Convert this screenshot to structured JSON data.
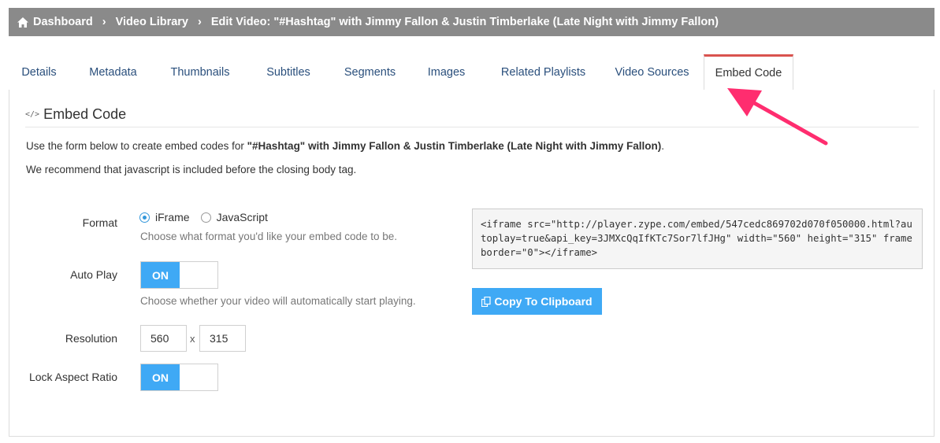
{
  "breadcrumb": {
    "items": [
      "Dashboard",
      "Video Library",
      "Edit Video: \"#Hashtag\" with Jimmy Fallon & Justin Timberlake (Late Night with Jimmy Fallon)"
    ],
    "separator": "›"
  },
  "tabs": [
    {
      "label": "Details",
      "active": false
    },
    {
      "label": "Metadata",
      "active": false
    },
    {
      "label": "Thumbnails",
      "active": false
    },
    {
      "label": "Subtitles",
      "active": false
    },
    {
      "label": "Segments",
      "active": false
    },
    {
      "label": "Images",
      "active": false
    },
    {
      "label": "Related Playlists",
      "active": false
    },
    {
      "label": "Video Sources",
      "active": false
    },
    {
      "label": "Embed Code",
      "active": true
    }
  ],
  "panel": {
    "icon": "</>",
    "title": "Embed Code",
    "intro_prefix": "Use the form below to create embed codes for ",
    "video_title": "\"#Hashtag\" with Jimmy Fallon & Justin Timberlake (Late Night with Jimmy Fallon)",
    "intro_suffix": ".",
    "recommend": "We recommend that javascript is included before the closing body tag."
  },
  "form": {
    "format": {
      "label": "Format",
      "options": [
        "iFrame",
        "JavaScript"
      ],
      "selected": "iFrame",
      "help": "Choose what format you'd like your embed code to be."
    },
    "auto_play": {
      "label": "Auto Play",
      "state": "ON",
      "help": "Choose whether your video will automatically start playing."
    },
    "resolution": {
      "label": "Resolution",
      "width": "560",
      "separator": "x",
      "height": "315"
    },
    "lock_aspect_ratio": {
      "label": "Lock Aspect Ratio",
      "state": "ON"
    }
  },
  "embed": {
    "code": "<iframe src=\"http://player.zype.com/embed/547cedc869702d070f050000.html?autoplay=true&api_key=3JMXcQqIfKTc7Sor7lfJHg\" width=\"560\" height=\"315\" frameborder=\"0\"></iframe>",
    "copy_label": "Copy To Clipboard"
  },
  "colors": {
    "breadcrumb_bg": "#8a8a8a",
    "accent_blue": "#3fa9f5",
    "active_tab_border": "#d9534f",
    "tab_text": "#2a4f7c",
    "annotation_arrow": "#ff2d6f"
  }
}
